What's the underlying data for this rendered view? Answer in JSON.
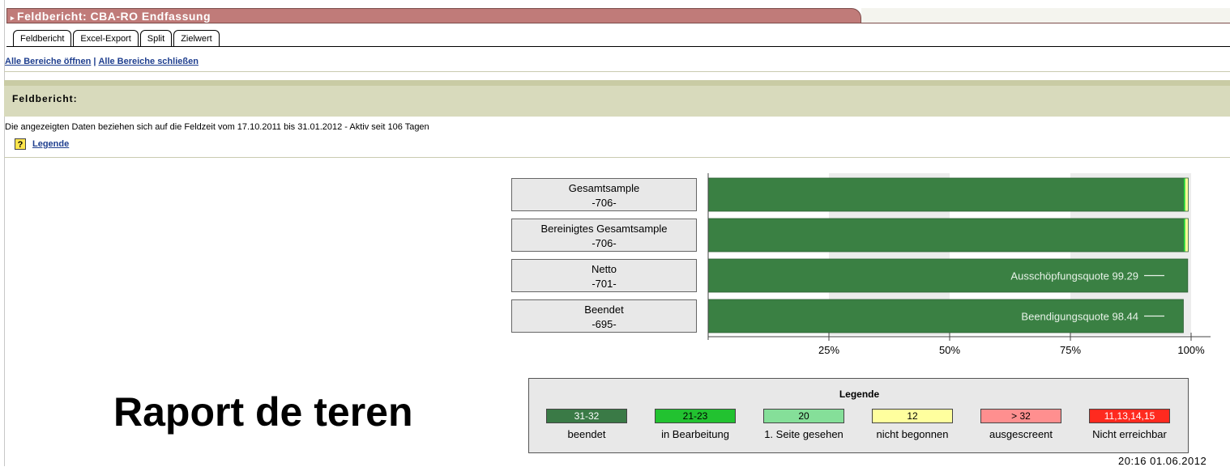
{
  "window": {
    "title": "Feldbericht: CBA-RO Endfassung"
  },
  "tabs": [
    "Feldbericht",
    "Excel-Export",
    "Split",
    "Zielwert"
  ],
  "links": {
    "open_all": "Alle Bereiche öffnen",
    "separator": "|",
    "close_all": "Alle Bereiche schließen"
  },
  "section": {
    "title": "Feldbericht:",
    "info": "Die angezeigten Daten beziehen sich auf die Feldzeit vom 17.10.2011 bis 31.01.2012 - Aktiv seit 106 Tagen",
    "legend_link": "Legende",
    "help_icon_text": "?"
  },
  "chart_data": {
    "type": "bar",
    "orientation": "horizontal",
    "categories": [
      {
        "name": "Gesamtsample",
        "count": "-706-"
      },
      {
        "name": "Bereinigtes Gesamtsample",
        "count": "-706-"
      },
      {
        "name": "Netto",
        "count": "-701-"
      },
      {
        "name": "Beendet",
        "count": "-695-"
      }
    ],
    "series": [
      {
        "name": "beendet",
        "color": "#3a8043",
        "values": [
          98.5,
          98.5,
          99.3,
          98.4
        ]
      },
      {
        "name": "in Bearbeitung",
        "color": "#1ed62f",
        "values": [
          0.3,
          0.3,
          0,
          0
        ]
      },
      {
        "name": "1. Seite gesehen",
        "color": "#8fe6a0",
        "values": [
          0,
          0,
          0,
          0
        ]
      },
      {
        "name": "nicht begonnen",
        "color": "#ffff99",
        "values": [
          0.6,
          0.6,
          0,
          0
        ]
      }
    ],
    "bar_annotations": [
      {
        "row": 2,
        "text": "Ausschöpfungsquote 99.29"
      },
      {
        "row": 3,
        "text": "Beendigungsquote 98.44"
      }
    ],
    "xticks": [
      "25%",
      "50%",
      "75%",
      "100%"
    ],
    "xlim": [
      0,
      100
    ]
  },
  "heading": "Raport de teren",
  "legend": {
    "title": "Legende",
    "items": [
      {
        "code": "31-32",
        "label": "beendet",
        "color": "#3a7a46"
      },
      {
        "code": "21-23",
        "label": "in Bearbeitung",
        "color": "#22c230"
      },
      {
        "code": "20",
        "label": "1. Seite gesehen",
        "color": "#85df99"
      },
      {
        "code": "12",
        "label": "nicht begonnen",
        "color": "#ffff9e"
      },
      {
        "code": "> 32",
        "label": "ausgescreent",
        "color": "#ff8f8f"
      },
      {
        "code": "11,13,14,15",
        "label": "Nicht erreichbar",
        "color": "#ff2a1f"
      }
    ]
  },
  "timestamp": "20:16 01.06.2012"
}
